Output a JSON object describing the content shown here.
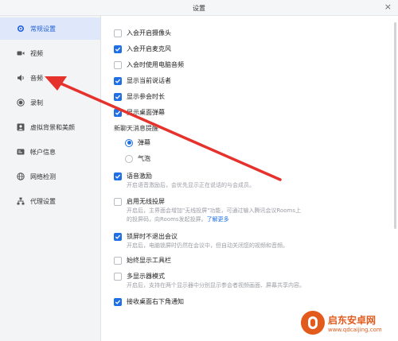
{
  "window": {
    "title": "设置",
    "close_glyph": "×"
  },
  "sidebar": {
    "items": [
      {
        "label": "常规设置",
        "icon": "gear-icon",
        "active": true
      },
      {
        "label": "视频",
        "icon": "video-icon"
      },
      {
        "label": "音频",
        "icon": "speaker-icon"
      },
      {
        "label": "录制",
        "icon": "record-icon"
      },
      {
        "label": "虚拟背景和美颜",
        "icon": "portrait-icon"
      },
      {
        "label": "帐户信息",
        "icon": "id-card-icon"
      },
      {
        "label": "网络检测",
        "icon": "network-icon"
      },
      {
        "label": "代理设置",
        "icon": "proxy-icon"
      }
    ]
  },
  "settings": {
    "camera_on_join": {
      "label": "入会开启摄像头",
      "checked": false
    },
    "mic_on_join": {
      "label": "入会开启麦克风",
      "checked": true
    },
    "pc_audio_on_join": {
      "label": "入会时使用电脑音频",
      "checked": false
    },
    "show_speaker": {
      "label": "显示当前说话者",
      "checked": true
    },
    "show_duration": {
      "label": "显示参会时长",
      "checked": true
    },
    "show_desktop_popup": {
      "label": "显示桌面弹幕",
      "checked": true
    },
    "chat_reminder": {
      "label": "新聊天消息提醒",
      "options": [
        {
          "label": "弹幕",
          "selected": true
        },
        {
          "label": "气泡",
          "selected": false
        }
      ]
    },
    "speech_incentive": {
      "label": "语音激励",
      "checked": true,
      "desc": "开启语音激励后，会优先显示正在说话的与会成员。"
    },
    "wireless_projection": {
      "label": "启用无线投屏",
      "checked": false,
      "desc_line1": "开启后，主界面会增加\"无线投屏\"功能，可通过输入腾讯会议Rooms上",
      "desc_line2": "的投屏码，向Rooms发起投屏。",
      "link": "了解更多"
    },
    "lock_screen": {
      "label": "锁屏时不退出会议",
      "checked": true,
      "desc": "开启后，电脑锁屏时仍然在会议中，但自动关闭您的视频和音频。"
    },
    "always_toolbar": {
      "label": "始终显示工具栏",
      "checked": false
    },
    "multi_display": {
      "label": "多显示器模式",
      "checked": false,
      "desc": "开启后，支持在两个显示器中分别显示参会者视频画面、屏幕共享内容。"
    },
    "desktop_notify": {
      "label": "接收桌面右下角通知",
      "checked": true
    }
  },
  "watermark": {
    "cn": "启东安卓网",
    "url": "www.qdcaijing.com"
  },
  "colors": {
    "accent": "#1f6fe5",
    "annotation_arrow": "#e5322d",
    "watermark": "#e25a1c"
  }
}
